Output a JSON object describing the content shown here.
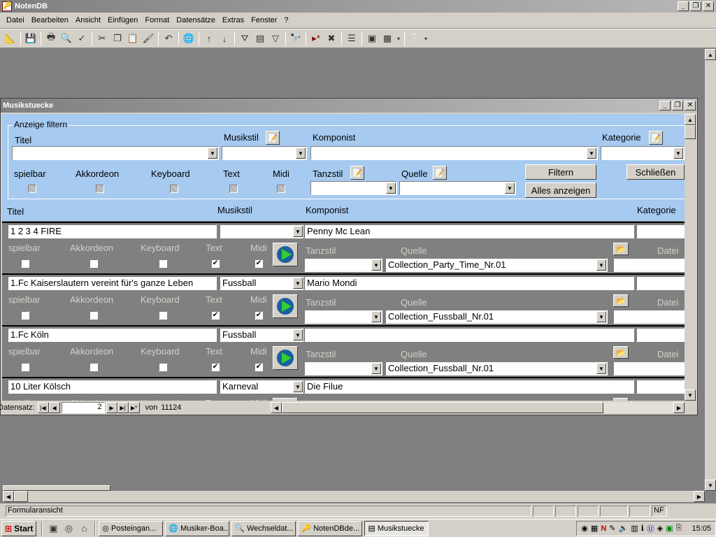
{
  "app": {
    "title": "NotenDB",
    "controls": [
      "_",
      "❐",
      "✕"
    ]
  },
  "menu": [
    "Datei",
    "Bearbeiten",
    "Ansicht",
    "Einfügen",
    "Format",
    "Datensätze",
    "Extras",
    "Fenster",
    "?"
  ],
  "form": {
    "title": "Musikstuecke",
    "filter": {
      "legend": "Anzeige filtern",
      "titel_label": "Titel",
      "musikstil_label": "Musikstil",
      "komponist_label": "Komponist",
      "kategorie_label": "Kategorie",
      "spielbar_label": "spielbar",
      "akkordeon_label": "Akkordeon",
      "keyboard_label": "Keyboard",
      "text_label": "Text",
      "midi_label": "Midi",
      "tanzstil_label": "Tanzstil",
      "quelle_label": "Quelle",
      "filtern_button": "Filtern",
      "alles_button": "Alles anzeigen",
      "schliessen_button": "Schließen"
    },
    "columns": {
      "titel": "Titel",
      "musikstil": "Musikstil",
      "komponist": "Komponist",
      "kategorie": "Kategorie"
    },
    "row_labels": {
      "spielbar": "spielbar",
      "akkordeon": "Akkordeon",
      "keyboard": "Keyboard",
      "text": "Text",
      "midi": "Midi",
      "tanzstil": "Tanzstil",
      "quelle": "Quelle",
      "datei": "Datei"
    },
    "records": [
      {
        "titel": "1 2 3 4 FIRE",
        "musikstil": "",
        "komponist": "Penny Mc Lean",
        "quelle": "Collection_Party_Time_Nr.01",
        "text": true,
        "midi": true
      },
      {
        "titel": "1.Fc Kaiserslautern vereint für's ganze Leben",
        "musikstil": "Fussball",
        "komponist": "Mario Mondi",
        "quelle": "Collection_Fussball_Nr.01",
        "text": true,
        "midi": true
      },
      {
        "titel": "1.Fc Köln",
        "musikstil": "Fussball",
        "komponist": "",
        "quelle": "Collection_Fussball_Nr.01",
        "text": true,
        "midi": true
      },
      {
        "titel": "10 Liter Kölsch",
        "musikstil": "Karneval",
        "komponist": "Die Filue",
        "quelle": "",
        "text": false,
        "midi": false
      }
    ],
    "nav": {
      "label": "Datensatz:",
      "current": "2",
      "of_label": "von",
      "total": "11124"
    }
  },
  "status": {
    "text": "Formularansicht",
    "nf": "NF"
  },
  "taskbar": {
    "start": "Start",
    "tasks": [
      "Posteingan...",
      "Musiker-Boa...",
      "Wechseldat...",
      "NotenDBde...",
      "Musikstuecke"
    ],
    "clock": "15:05"
  },
  "colors": {
    "header_bg": "#a6caf0",
    "detail_bg": "#808080",
    "face": "#d4d0c8"
  }
}
